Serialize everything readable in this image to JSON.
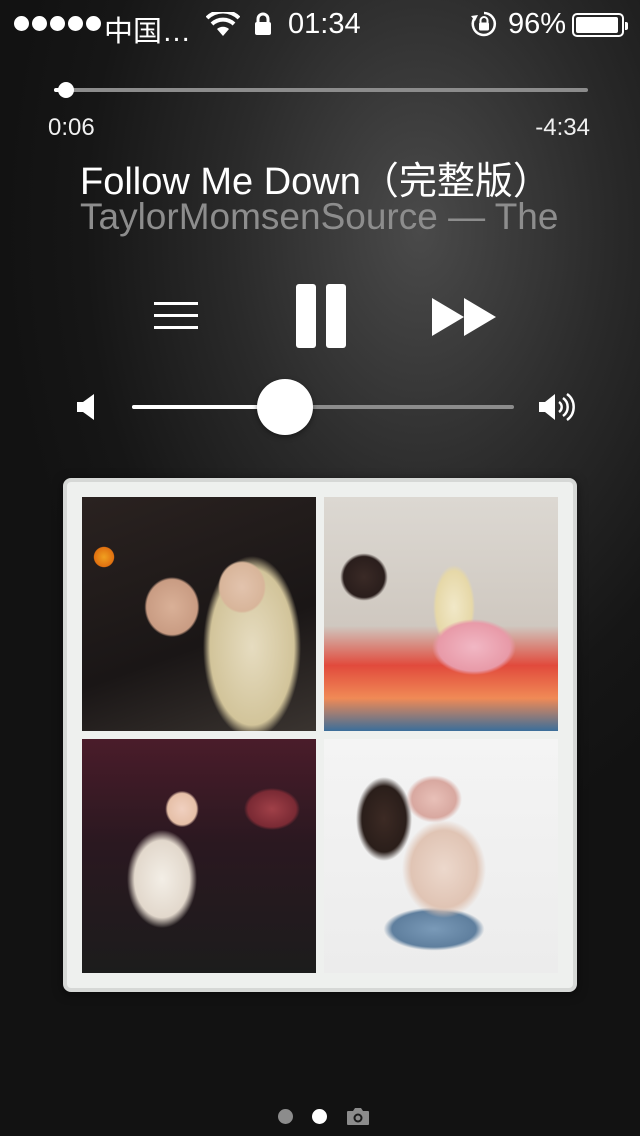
{
  "status_bar": {
    "carrier": "中国…",
    "time": "01:34",
    "battery_percent": "96%",
    "battery_level": 0.96,
    "signal_dots": 5,
    "icons": [
      "wifi-icon",
      "lock-icon",
      "rotation-lock-icon",
      "battery-icon"
    ]
  },
  "player": {
    "elapsed": "0:06",
    "remaining": "-4:34",
    "progress": 0.022,
    "title": "Follow Me Down（完整版）",
    "artist": "TaylorMomsenSource — The",
    "volume": 0.4
  },
  "controls": {
    "icons": [
      "list-icon",
      "pause-icon",
      "fast-forward-icon",
      "volume-low-icon",
      "volume-high-icon"
    ]
  },
  "artwork": {
    "tiles": [
      "photo-1",
      "photo-2",
      "photo-3",
      "photo-4"
    ]
  },
  "pager": {
    "pages": 2,
    "current": 2,
    "icon": "camera-icon"
  },
  "colors": {
    "background": "#161616",
    "track": "#8c8c8c",
    "foreground": "#ffffff",
    "secondary_text": "#8d8d8d"
  }
}
